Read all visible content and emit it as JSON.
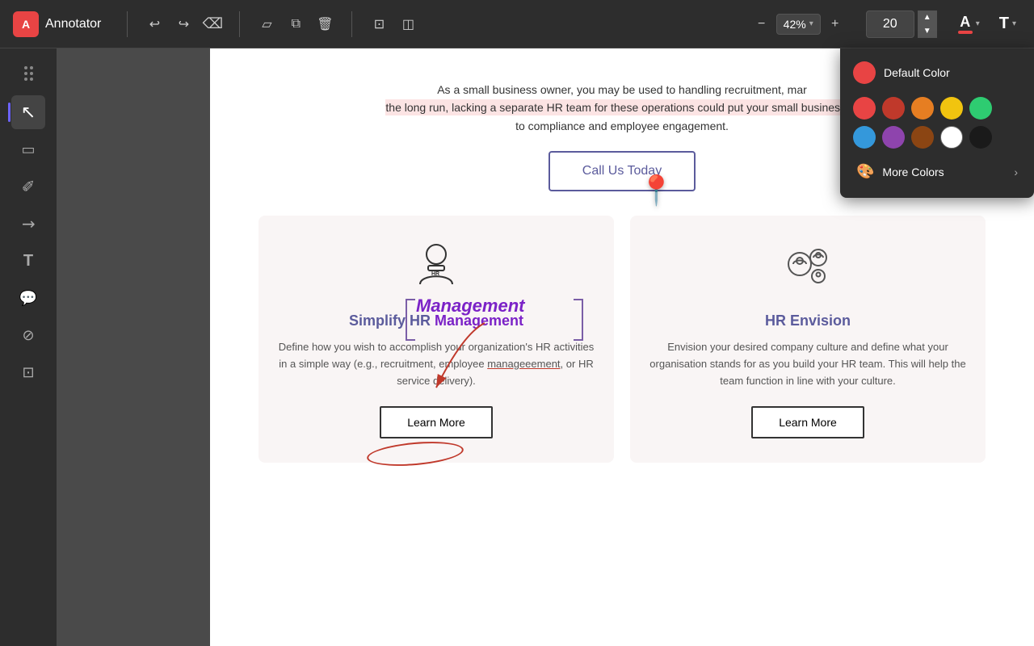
{
  "app": {
    "name": "Annotator",
    "logo_letter": "A"
  },
  "toolbar": {
    "undo_label": "↩",
    "redo_label": "↪",
    "clear_label": "✕",
    "frame_label": "⬜",
    "copy_label": "⧉",
    "delete_label": "🗑",
    "selection_label": "⊡",
    "layers_label": "⧉",
    "minus_label": "−",
    "zoom_value": "42%",
    "plus_label": "+",
    "font_size": "20",
    "font_color_letter": "A",
    "text_label": "T"
  },
  "sidebar": {
    "tools": [
      {
        "name": "select",
        "icon": "↖",
        "active": true
      },
      {
        "name": "shape",
        "icon": "▭",
        "active": false
      },
      {
        "name": "annotate",
        "icon": "✐",
        "active": false
      },
      {
        "name": "arrow",
        "icon": "↗",
        "active": false
      },
      {
        "name": "text",
        "icon": "T",
        "active": false
      },
      {
        "name": "comment",
        "icon": "💬",
        "active": false
      },
      {
        "name": "eraser",
        "icon": "⊘",
        "active": false
      },
      {
        "name": "crop",
        "icon": "⊡",
        "active": false
      }
    ]
  },
  "color_picker": {
    "default_color_label": "Default Color",
    "more_colors_label": "More Colors",
    "colors_row1": [
      "#e84444",
      "#c0392b",
      "#e67e22",
      "#f1c40f",
      "#2ecc71"
    ],
    "colors_row2": [
      "#3498db",
      "#8e44ad",
      "#8B4513",
      "#ffffff",
      "#1a1a1a"
    ]
  },
  "webpage": {
    "paragraph": "As a small business owner, you may be used to handling recruitment, mar the long run, lacking a separate HR team for these operations could put your small business at to compliance and employee engagement.",
    "highlight_text": "the long run, lacking a separate HR team for these operations could put your small business at",
    "call_button": "Call Us Today",
    "cards": [
      {
        "id": "simplify-hr",
        "title": "Simplify HR Management",
        "text": "Define how you wish to accomplish your organization's HR activities in a simple way (e.g., recruitment, employee manageeement, or HR service delivery).",
        "button": "Learn More",
        "icon": "👤"
      },
      {
        "id": "hr-envision",
        "title": "HR Envision",
        "text": "Envision your desired company culture and define what your organisation stands for as you build your HR team. This will help the team function in line with your culture.",
        "button": "Learn More",
        "icon": "⚙"
      }
    ],
    "annotation_label": "Management"
  }
}
